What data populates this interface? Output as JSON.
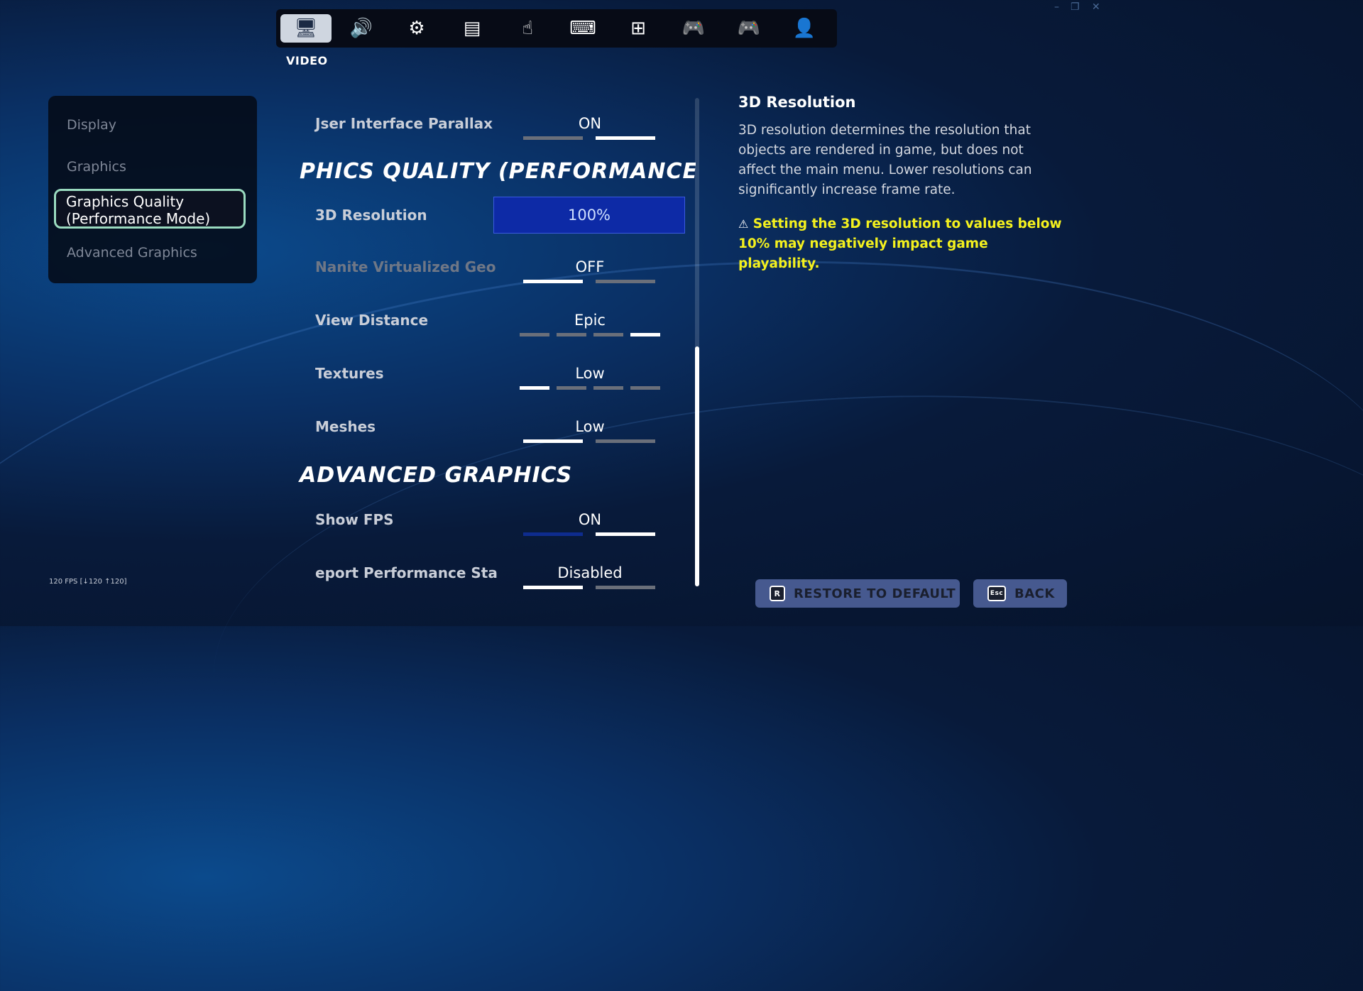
{
  "window_controls": {
    "minimize": "–",
    "restore": "❐",
    "close": "✕"
  },
  "tabs": [
    {
      "name": "video",
      "icon": "🖥"
    },
    {
      "name": "audio",
      "icon": "🔊"
    },
    {
      "name": "game",
      "icon": "⚙"
    },
    {
      "name": "accessibility",
      "icon": "▤"
    },
    {
      "name": "touch",
      "icon": "☝"
    },
    {
      "name": "keyboard",
      "icon": "⌨"
    },
    {
      "name": "game-ui",
      "icon": "⊞"
    },
    {
      "name": "controller",
      "icon": "🎮"
    },
    {
      "name": "controller-alt",
      "icon": "🎮"
    },
    {
      "name": "account",
      "icon": "👤"
    }
  ],
  "section_title": "VIDEO",
  "nav": {
    "display": "Display",
    "graphics": "Graphics",
    "graphics_quality": "Graphics Quality (Performance Mode)",
    "advanced": "Advanced Graphics"
  },
  "settings": {
    "ui_parallax": {
      "label": "Jser Interface Parallax",
      "value": "ON"
    },
    "heading_quality": "PHICS QUALITY (PERFORMANCE MO",
    "resolution": {
      "label": "3D Resolution",
      "value": "100%"
    },
    "nanite": {
      "label": "Nanite Virtualized Geo",
      "value": "OFF"
    },
    "view_distance": {
      "label": "View Distance",
      "value": "Epic"
    },
    "textures": {
      "label": "Textures",
      "value": "Low"
    },
    "meshes": {
      "label": "Meshes",
      "value": "Low"
    },
    "heading_advanced": "ADVANCED GRAPHICS",
    "show_fps": {
      "label": "Show FPS",
      "value": "ON"
    },
    "report_perf": {
      "label": "eport Performance Sta",
      "value": "Disabled"
    }
  },
  "description": {
    "title": "3D Resolution",
    "body": "3D resolution determines the resolution that objects are rendered in game, but does not affect the main menu.  Lower resolutions can significantly increase frame rate.",
    "warning_icon": "⚠",
    "warning": "Setting the 3D resolution to values below 10% may negatively impact game playability."
  },
  "fps_counter": "120 FPS [↓120 ↑120]",
  "buttons": {
    "restore_key": "R",
    "restore": "RESTORE TO DEFAULT",
    "back_key": "Esc",
    "back": "BACK"
  },
  "colors": {
    "accent_selected": "#9adbc0",
    "resolution_box": "#0d2aa6",
    "warning": "#f4f11e",
    "button": "#46598f"
  }
}
